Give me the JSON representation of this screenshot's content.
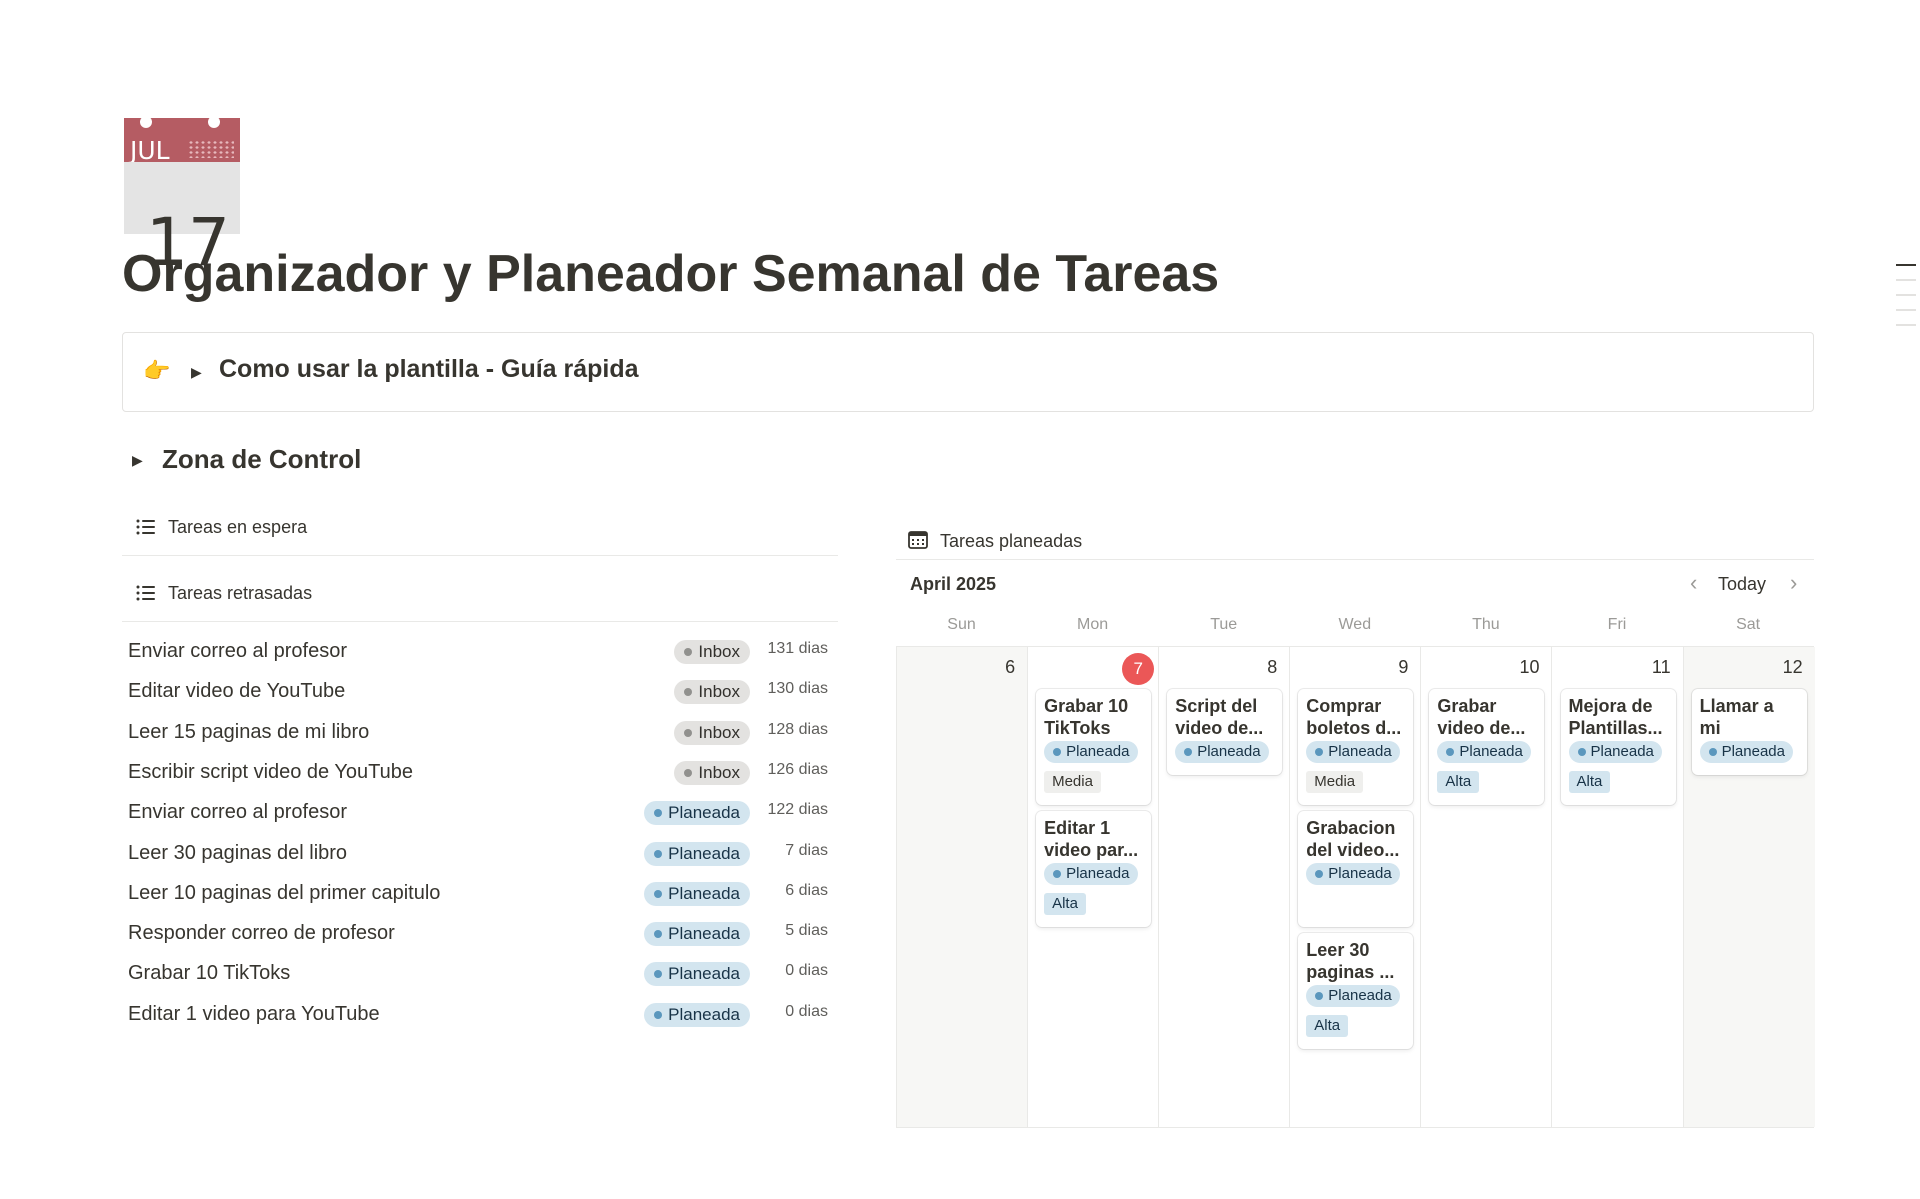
{
  "page": {
    "icon": {
      "month": "JUL",
      "day": "17"
    },
    "title": "Organizador y Planeador Semanal de Tareas"
  },
  "callout": {
    "emoji": "👉",
    "text": "Como usar la plantilla - Guía rápida"
  },
  "zone": {
    "title": "Zona de Control"
  },
  "views": {
    "waiting": {
      "title": "Tareas en espera"
    },
    "overdue": {
      "title": "Tareas retrasadas",
      "rows": [
        {
          "name": "Enviar correo al profesor",
          "status": "Inbox",
          "days": "131 dias"
        },
        {
          "name": "Editar video de YouTube",
          "status": "Inbox",
          "days": "130 dias"
        },
        {
          "name": "Leer 15 paginas de mi libro",
          "status": "Inbox",
          "days": "128 dias"
        },
        {
          "name": "Escribir script video de YouTube",
          "status": "Inbox",
          "days": "126 dias"
        },
        {
          "name": "Enviar correo al profesor",
          "status": "Planeada",
          "days": "122 dias"
        },
        {
          "name": "Leer 30 paginas del libro",
          "status": "Planeada",
          "days": "7 dias"
        },
        {
          "name": "Leer 10 paginas del primer capitulo",
          "status": "Planeada",
          "days": "6 dias"
        },
        {
          "name": "Responder correo de profesor",
          "status": "Planeada",
          "days": "5 dias"
        },
        {
          "name": "Grabar 10 TikToks",
          "status": "Planeada",
          "days": "0 dias"
        },
        {
          "name": "Editar 1 video para YouTube",
          "status": "Planeada",
          "days": "0 dias"
        }
      ]
    },
    "planned": {
      "title": "Tareas planeadas",
      "month": "April 2025",
      "today_label": "Today",
      "weekdays": [
        "Sun",
        "Mon",
        "Tue",
        "Wed",
        "Thu",
        "Fri",
        "Sat"
      ],
      "days": [
        {
          "num": "6",
          "today": false,
          "cards": []
        },
        {
          "num": "7",
          "today": true,
          "cards": [
            {
              "title": "Grabar 10 TikToks",
              "status": "Planeada",
              "priority": "Media"
            },
            {
              "title": "Editar 1 video par...",
              "status": "Planeada",
              "priority": "Alta"
            }
          ]
        },
        {
          "num": "8",
          "today": false,
          "cards": [
            {
              "title": "Script del video de...",
              "status": "Planeada",
              "priority": ""
            }
          ]
        },
        {
          "num": "9",
          "today": false,
          "cards": [
            {
              "title": "Comprar boletos d...",
              "status": "Planeada",
              "priority": "Media"
            },
            {
              "title": "Grabacion del video...",
              "status": "Planeada",
              "priority": ""
            },
            {
              "title": "Leer 30 paginas ...",
              "status": "Planeada",
              "priority": "Alta"
            }
          ]
        },
        {
          "num": "10",
          "today": false,
          "cards": [
            {
              "title": "Grabar video de...",
              "status": "Planeada",
              "priority": "Alta"
            }
          ]
        },
        {
          "num": "11",
          "today": false,
          "cards": [
            {
              "title": "Mejora de Plantillas...",
              "status": "Planeada",
              "priority": "Alta"
            }
          ]
        },
        {
          "num": "12",
          "today": false,
          "cards": [
            {
              "title": "Llamar a mi entrenad...",
              "status": "Planeada",
              "priority": ""
            }
          ]
        }
      ]
    }
  },
  "colors": {
    "inbox_bg": "#e3e2e0",
    "planeada_bg": "#d3e5ef",
    "today_red": "#eb5757",
    "icon_red": "#b55c63"
  },
  "icons": [
    "list-icon",
    "calendar-icon",
    "toggle-triangle-icon",
    "chevron-left-icon",
    "chevron-right-icon",
    "pointing-hand-icon"
  ]
}
